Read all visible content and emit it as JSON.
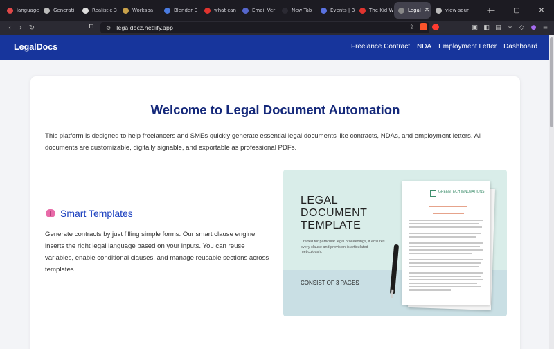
{
  "browser": {
    "tabs": [
      {
        "label": "language",
        "color": "#e04848"
      },
      {
        "label": "Generati",
        "color": "#bbbbbb"
      },
      {
        "label": "Realistic 3",
        "color": "#dddddd"
      },
      {
        "label": "Workspa",
        "color": "#c8a14a"
      },
      {
        "label": "Blender E",
        "color": "#4a7be0"
      },
      {
        "label": "what can",
        "color": "#e0342f"
      },
      {
        "label": "Email Ver",
        "color": "#5566cc"
      },
      {
        "label": "New Tab",
        "color": "#2b2a33"
      },
      {
        "label": "Events | B",
        "color": "#5a72e0"
      },
      {
        "label": "The Kid W",
        "color": "#e0342f"
      },
      {
        "label": "Legal",
        "color": "#888888",
        "active": true
      },
      {
        "label": "view-sour",
        "color": "#bbbbbb"
      }
    ],
    "url": "legaldocz.netlify.app",
    "shield_count": "1"
  },
  "site": {
    "brand": "LegalDocs",
    "nav": [
      "Freelance Contract",
      "NDA",
      "Employment Letter",
      "Dashboard"
    ]
  },
  "main": {
    "heading": "Welcome to Legal Document Automation",
    "intro": "This platform is designed to help freelancers and SMEs quickly generate essential legal documents like contracts, NDAs, and employment letters. All documents are customizable, digitally signable, and exportable as professional PDFs.",
    "feature": {
      "icon": "brain-icon",
      "title": "Smart Templates",
      "text": "Generate contracts by just filling simple forms. Our smart clause engine inserts the right legal language based on your inputs. You can reuse variables, enable conditional clauses, and manage reusable sections across templates."
    },
    "template_image": {
      "title": "LEGAL DOCUMENT TEMPLATE",
      "subtitle": "Crafted for particular legal proceedings, it ensures every clause and provision is articulated meticulously.",
      "pages": "CONSIST OF 3 PAGES",
      "logo": "GREENTECH INNOVATIONS"
    }
  }
}
